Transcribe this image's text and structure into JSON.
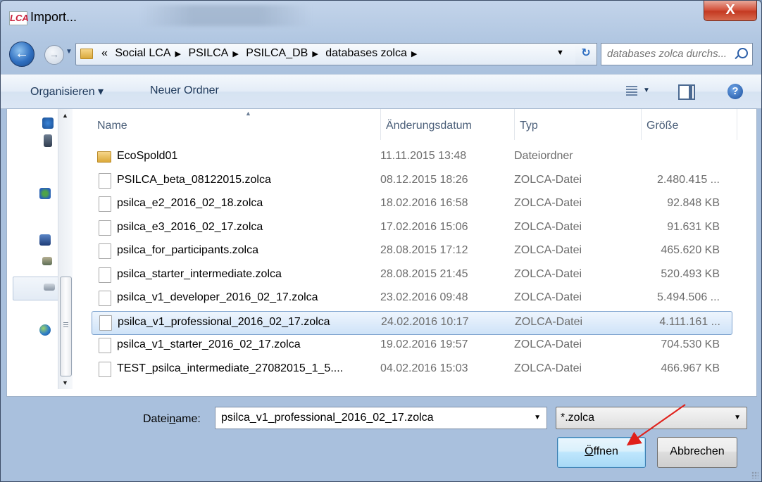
{
  "window": {
    "title": "Import...",
    "app_icon_text": "LCA",
    "close_glyph": "X"
  },
  "nav": {
    "back_glyph": "←",
    "forward_glyph": "→",
    "breadcrumb_lead": "«",
    "breadcrumb": [
      "Social LCA",
      "PSILCA",
      "PSILCA_DB",
      "databases zolca"
    ],
    "breadcrumb_sep": "▶",
    "refresh_glyph": "↻",
    "search_placeholder": "databases zolca durchs..."
  },
  "toolbar": {
    "organize_label": "Organisieren ▾",
    "new_folder_label": "Neuer Ordner",
    "help_glyph": "?"
  },
  "columns": {
    "name": "Name",
    "date": "Änderungsdatum",
    "type": "Typ",
    "size": "Größe"
  },
  "files": [
    {
      "name": "EcoSpold01",
      "date": "11.11.2015 13:48",
      "type": "Dateiordner",
      "size": "",
      "kind": "folder"
    },
    {
      "name": "PSILCA_beta_08122015.zolca",
      "date": "08.12.2015 18:26",
      "type": "ZOLCA-Datei",
      "size": "2.480.415 ...",
      "kind": "file"
    },
    {
      "name": "psilca_e2_2016_02_18.zolca",
      "date": "18.02.2016 16:58",
      "type": "ZOLCA-Datei",
      "size": "92.848 KB",
      "kind": "file"
    },
    {
      "name": "psilca_e3_2016_02_17.zolca",
      "date": "17.02.2016 15:06",
      "type": "ZOLCA-Datei",
      "size": "91.631 KB",
      "kind": "file"
    },
    {
      "name": "psilca_for_participants.zolca",
      "date": "28.08.2015 17:12",
      "type": "ZOLCA-Datei",
      "size": "465.620 KB",
      "kind": "file"
    },
    {
      "name": "psilca_starter_intermediate.zolca",
      "date": "28.08.2015 21:45",
      "type": "ZOLCA-Datei",
      "size": "520.493 KB",
      "kind": "file"
    },
    {
      "name": "psilca_v1_developer_2016_02_17.zolca",
      "date": "23.02.2016 09:48",
      "type": "ZOLCA-Datei",
      "size": "5.494.506 ...",
      "kind": "file"
    },
    {
      "name": "psilca_v1_professional_2016_02_17.zolca",
      "date": "24.02.2016 10:17",
      "type": "ZOLCA-Datei",
      "size": "4.111.161 ...",
      "kind": "file",
      "selected": true
    },
    {
      "name": "psilca_v1_starter_2016_02_17.zolca",
      "date": "19.02.2016 19:57",
      "type": "ZOLCA-Datei",
      "size": "704.530 KB",
      "kind": "file"
    },
    {
      "name": "TEST_psilca_intermediate_27082015_1_5....",
      "date": "04.02.2016 15:03",
      "type": "ZOLCA-Datei",
      "size": "466.967 KB",
      "kind": "file"
    }
  ],
  "bottom": {
    "filename_label_pre": "Datei",
    "filename_label_accel": "n",
    "filename_label_post": "ame:",
    "filename_value": "psilca_v1_professional_2016_02_17.zolca",
    "filter_value": "*.zolca",
    "open_label_accel": "Ö",
    "open_label_rest": "ffnen",
    "cancel_label": "Abbrechen"
  },
  "colors": {
    "selection_border": "#7da2ce",
    "annotation_arrow": "#e0201a"
  }
}
